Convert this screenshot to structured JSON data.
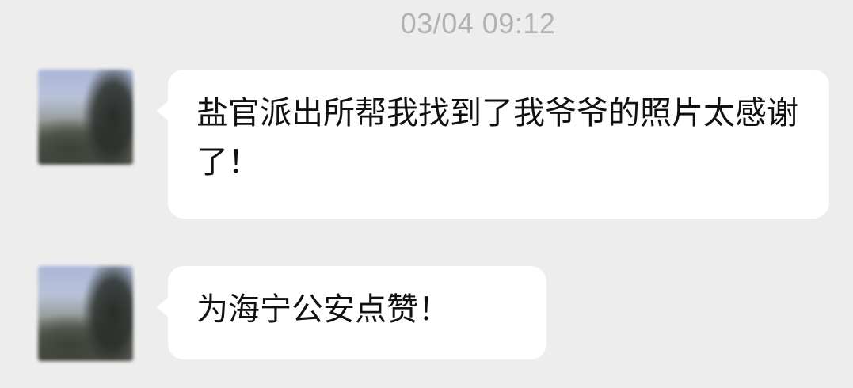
{
  "chat": {
    "timestamp": "03/04 09:12",
    "messages": [
      {
        "avatar_icon": "blurred-profile-avatar",
        "text": "盐官派出所帮我找到了我爷爷的照片太感谢了！"
      },
      {
        "avatar_icon": "blurred-profile-avatar",
        "text": "为海宁公安点赞！"
      }
    ]
  },
  "colors": {
    "background": "#ededed",
    "bubble": "#ffffff",
    "timestamp": "#b2b2b2",
    "text": "#111111"
  }
}
